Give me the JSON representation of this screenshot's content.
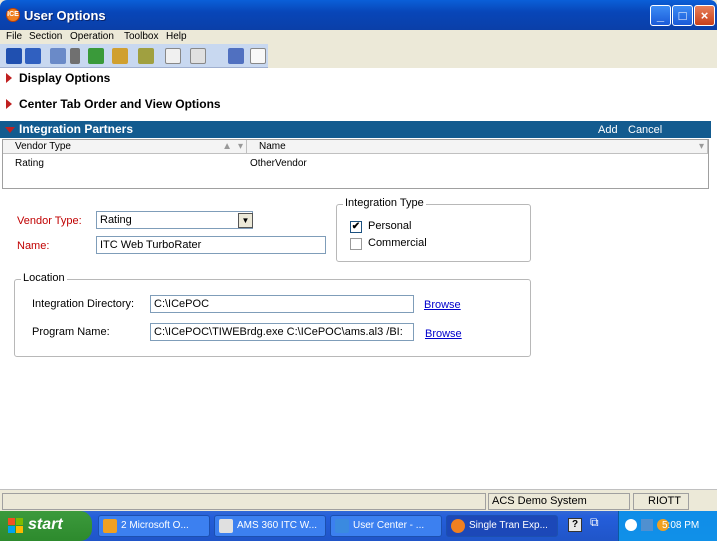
{
  "window": {
    "title": "User Options"
  },
  "menu": [
    "File",
    "Section",
    "Operation",
    "Toolbox",
    "Help"
  ],
  "sections": {
    "display": "Display Options",
    "center_tab": "Center Tab Order and View Options",
    "partners": "Integration Partners",
    "add": "Add",
    "cancel": "Cancel"
  },
  "grid": {
    "columns": [
      "Vendor Type",
      "Name"
    ],
    "rows": [
      {
        "vendor_type": "Rating",
        "name": "OtherVendor"
      }
    ]
  },
  "form": {
    "vendor_type_label": "Vendor Type:",
    "vendor_type_value": "Rating",
    "name_label": "Name:",
    "name_value": "ITC Web TurboRater",
    "integration_type_title": "Integration Type",
    "personal_label": "Personal",
    "personal_checked": true,
    "commercial_label": "Commercial",
    "commercial_checked": false,
    "location_title": "Location",
    "integration_dir_label": "Integration Directory:",
    "integration_dir_value": "C:\\ICePOC",
    "program_name_label": "Program Name:",
    "program_name_value": "C:\\ICePOC\\TIWEBrdg.exe C:\\ICePOC\\ams.al3 /BI:",
    "browse_label": "Browse"
  },
  "status": {
    "system": "ACS Demo System",
    "user": "RIOTT"
  },
  "taskbar": {
    "start": "start",
    "tasks": [
      "2 Microsoft O...",
      "AMS 360 ITC W...",
      "User Center - ...",
      "Single Tran Exp..."
    ],
    "clock": "5:08 PM"
  },
  "colors": {
    "title_bar": "#0846b8",
    "section_bar": "#135b8f",
    "required_label": "#c00000",
    "link": "#0000cc"
  }
}
